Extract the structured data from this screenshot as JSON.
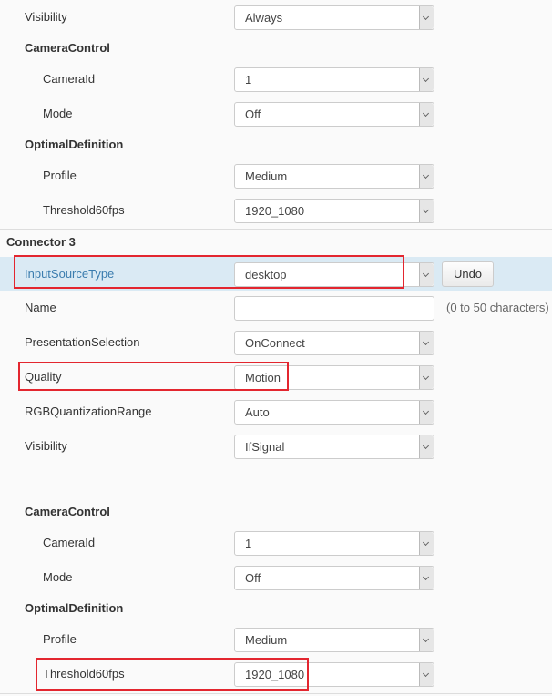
{
  "top_section": {
    "visibility": {
      "label": "Visibility",
      "value": "Always"
    },
    "camera_control": {
      "title": "CameraControl",
      "camera_id": {
        "label": "CameraId",
        "value": "1"
      },
      "mode": {
        "label": "Mode",
        "value": "Off"
      }
    },
    "optimal_definition": {
      "title": "OptimalDefinition",
      "profile": {
        "label": "Profile",
        "value": "Medium"
      },
      "threshold": {
        "label": "Threshold60fps",
        "value": "1920_1080"
      }
    }
  },
  "connector3": {
    "title": "Connector 3",
    "input_source_type": {
      "label": "InputSourceType",
      "value": "desktop",
      "undo_label": "Undo"
    },
    "name": {
      "label": "Name",
      "value": "",
      "hint": "(0 to 50 characters)"
    },
    "presentation_selection": {
      "label": "PresentationSelection",
      "value": "OnConnect"
    },
    "quality": {
      "label": "Quality",
      "value": "Motion"
    },
    "rgb_quantization_range": {
      "label": "RGBQuantizationRange",
      "value": "Auto"
    },
    "visibility": {
      "label": "Visibility",
      "value": "IfSignal"
    },
    "camera_control": {
      "title": "CameraControl",
      "camera_id": {
        "label": "CameraId",
        "value": "1"
      },
      "mode": {
        "label": "Mode",
        "value": "Off"
      }
    },
    "optimal_definition": {
      "title": "OptimalDefinition",
      "profile": {
        "label": "Profile",
        "value": "Medium"
      },
      "threshold": {
        "label": "Threshold60fps",
        "value": "1920_1080"
      }
    }
  },
  "colors": {
    "highlight_bg": "#daeaf4",
    "highlight_label": "#3a7cae",
    "annotation_red": "#e3262f",
    "page_bg": "#fafafa"
  }
}
